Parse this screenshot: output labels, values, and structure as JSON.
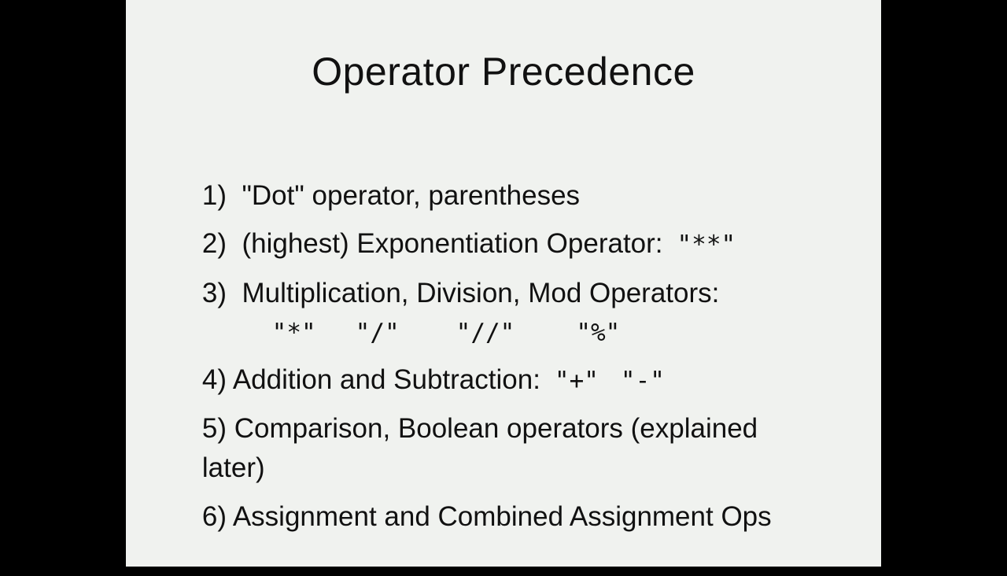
{
  "slide": {
    "title": "Operator Precedence",
    "items": [
      {
        "text": "1)  \"Dot\" operator, parentheses"
      },
      {
        "text": "2)  (highest) Exponentiation Operator:",
        "ops": [
          "\"**\""
        ]
      },
      {
        "text": "3)  Multiplication, Division, Mod Operators:",
        "ops": [
          "\"*\"",
          "\"/\"",
          "\"//\"",
          "\"%\""
        ]
      },
      {
        "text": "4) Addition and Subtraction:",
        "ops": [
          "\"+\"",
          "\"-\""
        ]
      },
      {
        "text": "5) Comparison, Boolean operators (explained",
        "continuation": "later)"
      },
      {
        "text": "6) Assignment and Combined Assignment Ops"
      }
    ]
  },
  "colors": {
    "background": "#000000",
    "slide": "#f0f2ef",
    "text": "#111111"
  }
}
